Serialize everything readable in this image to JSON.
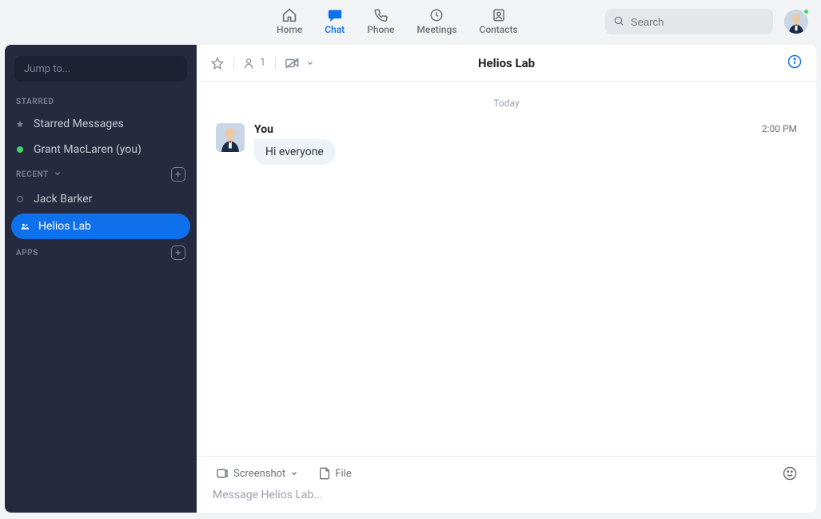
{
  "nav": {
    "home": "Home",
    "chat": "Chat",
    "phone": "Phone",
    "meetings": "Meetings",
    "contacts": "Contacts"
  },
  "search": {
    "placeholder": "Search"
  },
  "sidebar": {
    "jump_placeholder": "Jump to...",
    "starred_hdr": "STARRED",
    "starred_messages": "Starred Messages",
    "self_user": "Grant MacLaren (you)",
    "recent_hdr": "RECENT",
    "recent": [
      {
        "label": "Jack Barker"
      },
      {
        "label": "Helios Lab"
      }
    ],
    "apps_hdr": "APPS"
  },
  "chat": {
    "participants_count": "1",
    "title": "Helios Lab",
    "date_separator": "Today",
    "message": {
      "sender": "You",
      "time": "2:00 PM",
      "text": "Hi everyone"
    },
    "composer": {
      "screenshot": "Screenshot",
      "file": "File",
      "placeholder": "Message Helios Lab..."
    }
  }
}
